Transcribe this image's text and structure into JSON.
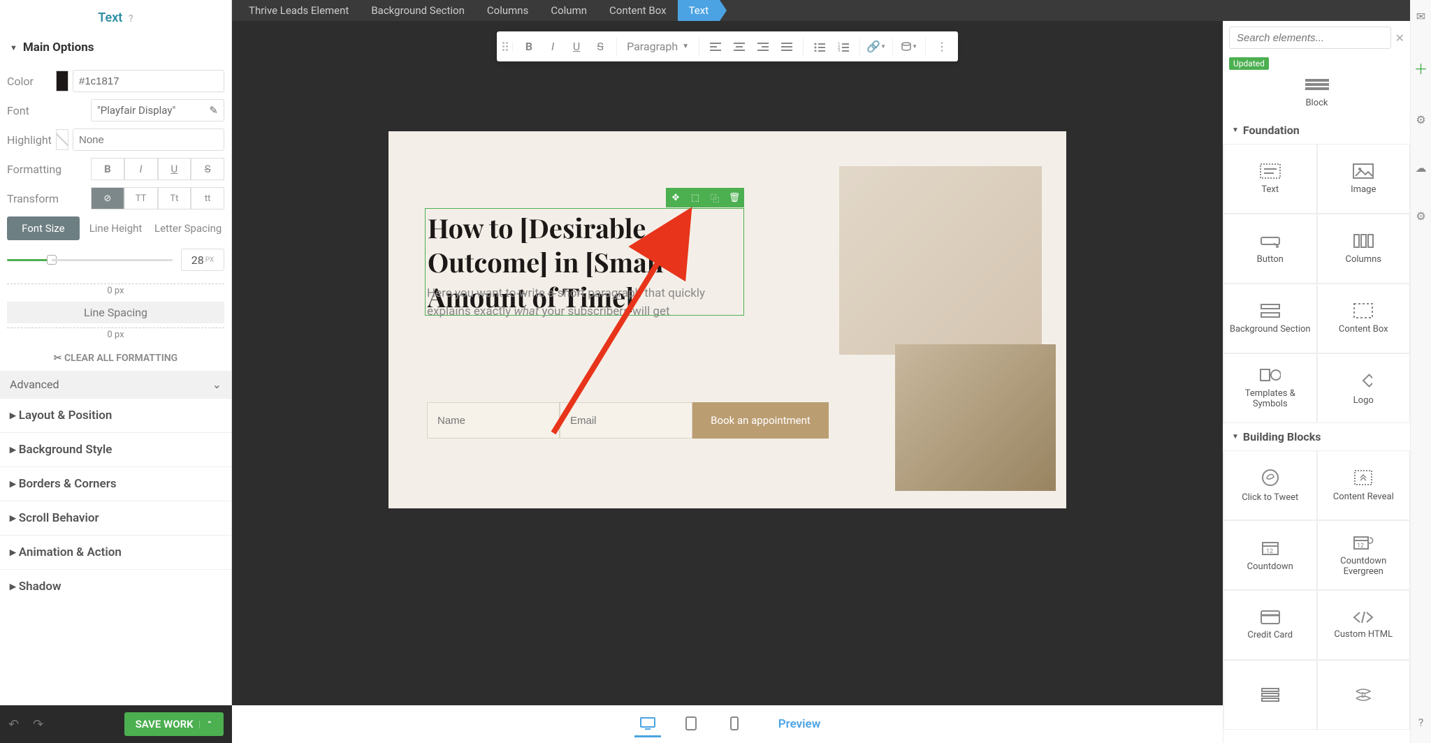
{
  "breadcrumb": {
    "items": [
      "Thrive Leads Element",
      "Background Section",
      "Columns",
      "Column",
      "Content Box",
      "Text"
    ],
    "activeIndex": 5
  },
  "leftPanel": {
    "title": "Text",
    "sections": {
      "mainOptions": "Main Options",
      "advanced": "Advanced",
      "items": [
        "Layout & Position",
        "Background Style",
        "Borders & Corners",
        "Scroll Behavior",
        "Animation & Action",
        "Shadow"
      ]
    },
    "color": {
      "label": "Color",
      "value": "#1c1817"
    },
    "font": {
      "label": "Font",
      "value": "\"Playfair Display\""
    },
    "highlight": {
      "label": "Highlight",
      "placeholder": "None"
    },
    "formatting": {
      "label": "Formatting"
    },
    "transform": {
      "label": "Transform",
      "opts": [
        "⊘",
        "TT",
        "Tt",
        "tt"
      ]
    },
    "typoTabs": [
      "Font Size",
      "Line Height",
      "Letter Spacing"
    ],
    "fontSizeVal": "28",
    "fontSizeUnit": "PX",
    "lineSpacing": "Line Spacing",
    "zeroPx": "0 px",
    "clearAll": "CLEAR ALL FORMATTING"
  },
  "bottomLeft": {
    "save": "SAVE WORK"
  },
  "toolbar": {
    "paragraph": "Paragraph"
  },
  "preview": {
    "h1a": "How to ",
    "h1b": "[Desirable Outcome] ",
    "h1c": "in ",
    "h1d": "[Small Amount of Time]",
    "desc1": "Here you want to write a short paragraph that quickly explains exactly ",
    "descEm": "what",
    "desc2": " your subscribers will get",
    "namePh": "Name",
    "emailPh": "Email",
    "btnLabel": "Book an appointment"
  },
  "bottomCenter": {
    "preview": "Preview"
  },
  "rightPanel": {
    "searchPlaceholder": "Search elements...",
    "updatedBadge": "Updated",
    "blockLabel": "Block",
    "foundation": "Foundation",
    "buildingBlocks": "Building Blocks",
    "foundationItems": [
      "Text",
      "Image",
      "Button",
      "Columns",
      "Background Section",
      "Content Box",
      "Templates & Symbols",
      "Logo"
    ],
    "blockItems": [
      "Click to Tweet",
      "Content Reveal",
      "Countdown",
      "Countdown Evergreen",
      "Credit Card",
      "Custom HTML"
    ]
  }
}
